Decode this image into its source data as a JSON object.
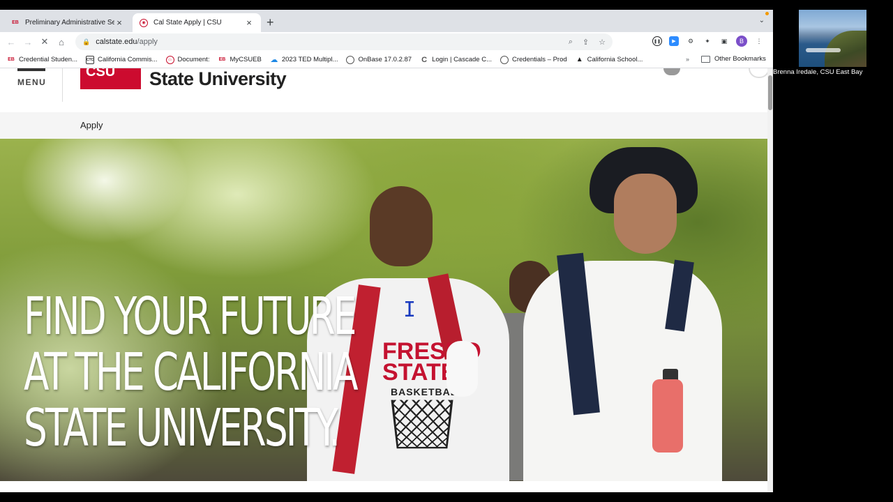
{
  "tabs": [
    {
      "label": "Preliminary Administrative Ser",
      "favicon": "EB",
      "active": false
    },
    {
      "label": "Cal State Apply | CSU",
      "favicon": "CSU",
      "active": true
    }
  ],
  "toolbar": {
    "url_host": "calstate.edu",
    "url_path": "/apply"
  },
  "profile_initial": "B",
  "bookmarks": [
    {
      "label": "Credential Studen...",
      "icon": "eb-icon",
      "icon_text": "EB"
    },
    {
      "label": "California Commis...",
      "icon": "ctc-icon",
      "icon_text": "CTC"
    },
    {
      "label": "Document:",
      "icon": "document-icon",
      "icon_text": "DOC"
    },
    {
      "label": "MyCSUEB",
      "icon": "eb-icon",
      "icon_text": "EB"
    },
    {
      "label": "2023 TED Multipl...",
      "icon": "cloud-icon",
      "icon_text": "☁"
    },
    {
      "label": "OnBase 17.0.2.87",
      "icon": "globe-icon",
      "icon_text": ""
    },
    {
      "label": "Login | Cascade C...",
      "icon": "cascade-icon",
      "icon_text": "C"
    },
    {
      "label": "Credentials – Prod",
      "icon": "globe-icon",
      "icon_text": ""
    },
    {
      "label": "California School...",
      "icon": "graduation-cap-icon",
      "icon_text": "🎓"
    }
  ],
  "other_bookmarks": "Other Bookmarks",
  "site": {
    "menu_label": "MENU",
    "logo_block_text": "CSU",
    "logo_text": "State University",
    "subnav_apply": "Apply",
    "headline": [
      "FIND YOUR FUTURE",
      "AT THE CALIFORNIA",
      "STATE UNIVERSITY."
    ],
    "shirt_text_1": "FRESNO",
    "shirt_text_2": "STATE",
    "shirt_text_3": "BASKETBALL"
  },
  "participant": {
    "name": "Brenna Iredale, CSU East Bay"
  },
  "colors": {
    "csu_red": "#cc0b2f",
    "tab_bar": "#dee1e6",
    "profile": "#7b4fc9"
  }
}
